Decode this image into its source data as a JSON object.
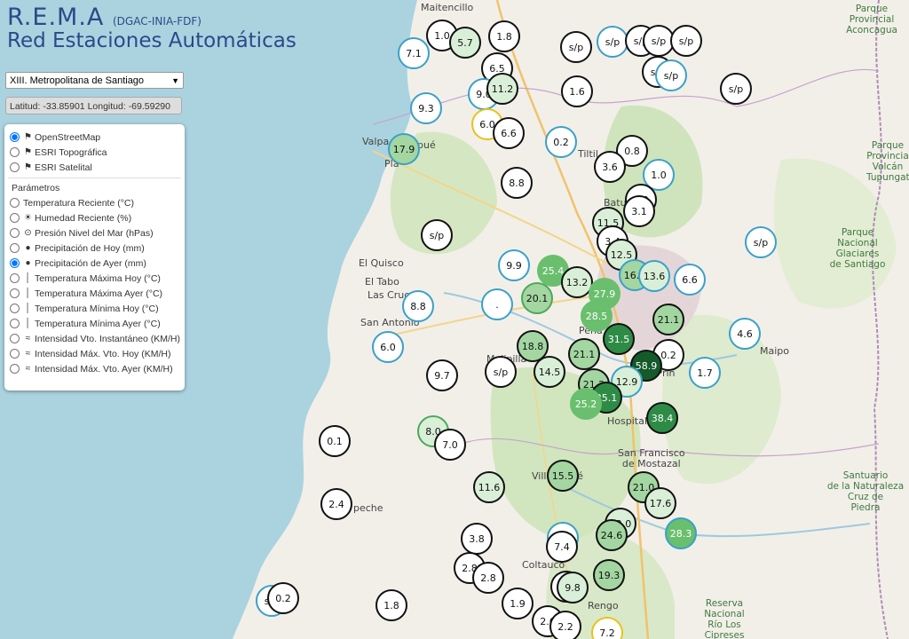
{
  "header": {
    "title": "R.E.M.A",
    "subtitle_small": "(DGAC-INIA-FDF)",
    "subtitle": "Red Estaciones Automáticas"
  },
  "region_select": {
    "selected": "XIII. Metropolitana de Santiago"
  },
  "coords": {
    "text": "Latitud: -33.85901 Longitud: -69.59290"
  },
  "base_layers": [
    {
      "label": "OpenStreetMap",
      "checked": true
    },
    {
      "label": "ESRI Topográfica",
      "checked": false
    },
    {
      "label": "ESRI Satelital",
      "checked": false
    }
  ],
  "parameters": {
    "heading": "Parámetros",
    "items": [
      {
        "label": "Temperatura Reciente (°C)",
        "icon": "none",
        "checked": false
      },
      {
        "label": "Humedad Reciente (%)",
        "icon": "droplet-sun-icon",
        "checked": false
      },
      {
        "label": "Presión Nivel del Mar (hPas)",
        "icon": "pressure-icon",
        "checked": false
      },
      {
        "label": "Precipitación de Hoy (mm)",
        "icon": "drop-icon",
        "checked": false
      },
      {
        "label": "Precipitación de Ayer (mm)",
        "icon": "drop-icon",
        "checked": true
      },
      {
        "label": "Temperatura Máxima Hoy (°C)",
        "icon": "thermometer-icon",
        "checked": false
      },
      {
        "label": "Temperatura Máxima Ayer (°C)",
        "icon": "thermometer-icon",
        "checked": false
      },
      {
        "label": "Temperatura Mínima Hoy (°C)",
        "icon": "thermometer-icon",
        "checked": false
      },
      {
        "label": "Temperatura Mínima Ayer (°C)",
        "icon": "thermometer-icon",
        "checked": false
      },
      {
        "label": "Intensidad Vto. Instantáneo (KM/H)",
        "icon": "wind-icon",
        "checked": false
      },
      {
        "label": "Intensidad Máx. Vto. Hoy (KM/H)",
        "icon": "wind-icon",
        "checked": false
      },
      {
        "label": "Intensidad Máx. Vto. Ayer (KM/H)",
        "icon": "wind-icon",
        "checked": false
      }
    ]
  },
  "map_labels": {
    "maitencillo": "Maitencillo",
    "valparaiso": "Valpa",
    "casablanca_part": "Pla",
    "quilpue": "pué",
    "tiltil": "Tiltil",
    "batuco": "Batuco",
    "el_quisco": "El Quisco",
    "el_tabo": "El Tabo",
    "las_cruces": "Las Cruces",
    "san_antonio": "San Antonio",
    "melipilla": "Melipilla",
    "hospital": "Hospital",
    "san_francisco": "San Francisco\nde Mostazal",
    "villa_alhue": "Villa Alhué",
    "coltauco": "Coltauco",
    "rengo": "Rengo",
    "peñaflor": "Peña",
    "el_principal": "El Prin",
    "pichidegua": "peche",
    "aconcagua_park": "Parque\nProvincial\nAconcagua",
    "volcan_park": "Parque\nProvincia\nVolcán\nTupungat",
    "glaciares_park": "Parque\nNacional\nGlaciares\nde Santiago",
    "santuario": "Santuario\nde la Naturaleza\nCruz de\nPiedra",
    "rio_cipreses": "Reserva\nNacional\nRío Los\nCipreses",
    "maipo": "Maipo"
  },
  "stations": [
    {
      "v": "1.0",
      "c": "white"
    },
    {
      "v": "5.7",
      "c": "light"
    },
    {
      "v": "1.8",
      "c": "white"
    },
    {
      "v": "7.1",
      "c": "white",
      "b": "blue"
    },
    {
      "v": "s/p",
      "c": "white"
    },
    {
      "v": "s/p",
      "c": "white",
      "b": "blue"
    },
    {
      "v": "s/p",
      "c": "white"
    },
    {
      "v": "s/p",
      "c": "white"
    },
    {
      "v": "s/p",
      "c": "white"
    },
    {
      "v": "6.5",
      "c": "white"
    },
    {
      "v": "1.6",
      "c": "white"
    },
    {
      "v": "s/p",
      "c": "white"
    },
    {
      "v": "s/p",
      "c": "white",
      "b": "blue"
    },
    {
      "v": "s/p",
      "c": "white"
    },
    {
      "v": "9.0",
      "c": "white",
      "b": "blue"
    },
    {
      "v": "11.2",
      "c": "light"
    },
    {
      "v": "9.3",
      "c": "white",
      "b": "blue"
    },
    {
      "v": "6.0",
      "c": "white",
      "b": "yellow"
    },
    {
      "v": "6.6",
      "c": "white"
    },
    {
      "v": "0.2",
      "c": "white",
      "b": "blue"
    },
    {
      "v": "17.9",
      "c": "mid",
      "b": "blue"
    },
    {
      "v": "0.8",
      "c": "white"
    },
    {
      "v": "3.6",
      "c": "white"
    },
    {
      "v": "1.0",
      "c": "white",
      "b": "blue"
    },
    {
      "v": "8.8",
      "c": "white"
    },
    {
      "v": "2.0",
      "c": "white"
    },
    {
      "v": "3.1",
      "c": "white"
    },
    {
      "v": "s/p",
      "c": "white"
    },
    {
      "v": "11.5",
      "c": "light"
    },
    {
      "v": "3.4",
      "c": "white"
    },
    {
      "v": "12.5",
      "c": "light"
    },
    {
      "v": "s/p",
      "c": "white",
      "b": "blue"
    },
    {
      "v": "9.9",
      "c": "white",
      "b": "blue"
    },
    {
      "v": "25.4",
      "c": "green",
      "b": "none"
    },
    {
      "v": "13.2",
      "c": "light"
    },
    {
      "v": "16.7",
      "c": "mid",
      "b": "blue"
    },
    {
      "v": "13.6",
      "c": "light",
      "b": "blue"
    },
    {
      "v": "6.6",
      "c": "white",
      "b": "blue"
    },
    {
      "v": "20.1",
      "c": "mid",
      "b": "green"
    },
    {
      "v": ".",
      "c": "white",
      "b": "blue"
    },
    {
      "v": "27.9",
      "c": "green",
      "b": "none"
    },
    {
      "v": "8.8",
      "c": "white",
      "b": "blue"
    },
    {
      "v": "28.5",
      "c": "green",
      "b": "none"
    },
    {
      "v": "21.1",
      "c": "mid"
    },
    {
      "v": "6.0",
      "c": "white",
      "b": "blue"
    },
    {
      "v": "4.6",
      "c": "white",
      "b": "blue"
    },
    {
      "v": "31.5",
      "c": "dark"
    },
    {
      "v": "18.8",
      "c": "mid"
    },
    {
      "v": "21.1",
      "c": "mid"
    },
    {
      "v": "0.2",
      "c": "white"
    },
    {
      "v": "58.9",
      "c": "darkest"
    },
    {
      "v": "s/p",
      "c": "white"
    },
    {
      "v": "14.5",
      "c": "light"
    },
    {
      "v": "9.7",
      "c": "white"
    },
    {
      "v": "1.7",
      "c": "white",
      "b": "blue"
    },
    {
      "v": "21.2",
      "c": "mid"
    },
    {
      "v": "12.9",
      "c": "light",
      "b": "blue"
    },
    {
      "v": "35.1",
      "c": "dark"
    },
    {
      "v": "25.2",
      "c": "green",
      "b": "none"
    },
    {
      "v": "38.4",
      "c": "dark"
    },
    {
      "v": "8.0",
      "c": "light",
      "b": "green"
    },
    {
      "v": "0.1",
      "c": "white"
    },
    {
      "v": "7.0",
      "c": "white"
    },
    {
      "v": "15.5",
      "c": "mid"
    },
    {
      "v": "11.6",
      "c": "light"
    },
    {
      "v": "21.0",
      "c": "mid"
    },
    {
      "v": "17.6",
      "c": "light"
    },
    {
      "v": "2.4",
      "c": "white"
    },
    {
      "v": "12.0",
      "c": "light"
    },
    {
      "v": "24.6",
      "c": "mid"
    },
    {
      "v": "28.3",
      "c": "green",
      "b": "blue"
    },
    {
      "v": "3.8",
      "c": "white"
    },
    {
      "v": "9.9",
      "c": "white",
      "b": "blue"
    },
    {
      "v": "7.4",
      "c": "white"
    },
    {
      "v": "2.8",
      "c": "white"
    },
    {
      "v": "2.8",
      "c": "white"
    },
    {
      "v": "5.8",
      "c": "white"
    },
    {
      "v": "9.8",
      "c": "light"
    },
    {
      "v": "19.3",
      "c": "mid"
    },
    {
      "v": "s/p",
      "c": "white",
      "b": "blue"
    },
    {
      "v": "0.2",
      "c": "white"
    },
    {
      "v": "1.8",
      "c": "white"
    },
    {
      "v": "1.9",
      "c": "white"
    },
    {
      "v": "2.6",
      "c": "white"
    },
    {
      "v": "2.2",
      "c": "white"
    },
    {
      "v": "7.2",
      "c": "white",
      "b": "yellow"
    }
  ],
  "colors": {
    "title": "#2a4a8a",
    "sea": "#aad3df",
    "fill_white": "#ffffff",
    "fill_light": "#d9efd8",
    "fill_mid": "#a3d6a1",
    "fill_green": "#6abf6e",
    "fill_dark": "#2e8b45",
    "fill_darkest": "#145a2a"
  }
}
